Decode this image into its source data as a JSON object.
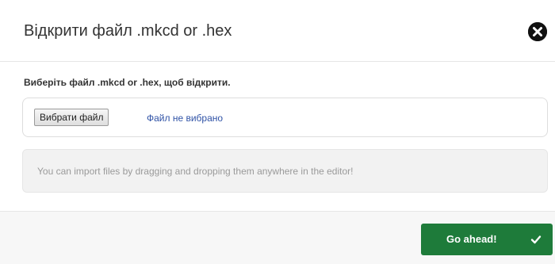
{
  "dialog": {
    "title": "Відкрити файл .mkcd or .hex",
    "close_icon": "close-circle-icon"
  },
  "body": {
    "prompt": "Виберіть файл .mkcd or .hex, щоб відкрити.",
    "file_input": {
      "button_label": "Вибрати файл",
      "status_text": "Файл не вибрано"
    },
    "info": "You can import files by dragging and dropping them anywhere in the editor!"
  },
  "footer": {
    "submit_label": "Go ahead!",
    "submit_icon": "checkmark-icon"
  },
  "colors": {
    "accent_green": "#1e7b3a",
    "link_blue": "#2f52a6"
  }
}
